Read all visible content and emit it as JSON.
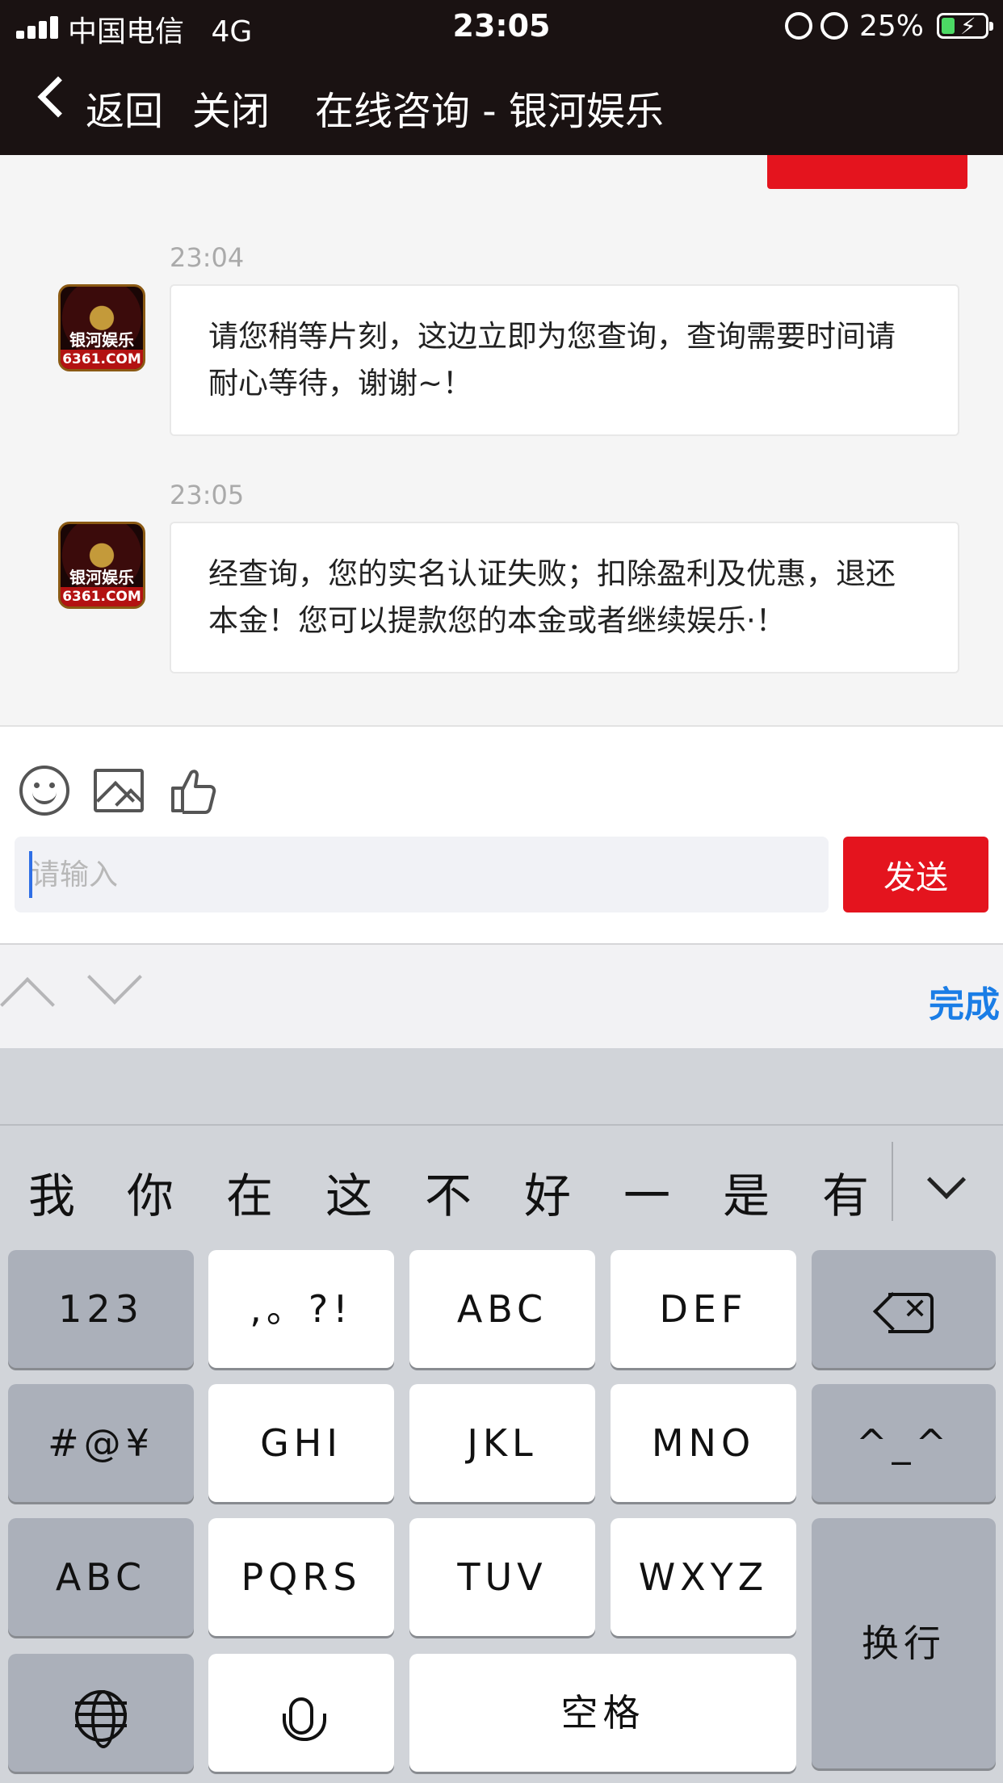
{
  "status_bar": {
    "carrier": "中国电信",
    "network": "4G",
    "time": "23:05",
    "battery_percent": "25%",
    "icons": [
      "signal-icon",
      "orientation-lock-icon",
      "alarm-icon",
      "battery-charging-icon"
    ]
  },
  "nav": {
    "back_label": "返回",
    "close_label": "关闭",
    "title": "在线咨询 - 银河娱乐"
  },
  "avatar": {
    "name": "银河娱乐",
    "domain": "6361.COM"
  },
  "messages": [
    {
      "time": "23:04",
      "text": "请您稍等片刻，这边立即为您查询，查询需要时间请耐心等待，谢谢~！"
    },
    {
      "time": "23:05",
      "text": "经查询，您的实名认证失败；扣除盈利及优惠，退还本金！您可以提款您的本金或者继续娱乐·！"
    }
  ],
  "composer": {
    "tools": [
      "emoji-icon",
      "image-icon",
      "thumbs-up-icon"
    ],
    "placeholder": "请输入",
    "value": "",
    "send_label": "发送"
  },
  "accessory": {
    "done_label": "完成"
  },
  "keyboard": {
    "candidates": [
      "我",
      "你",
      "在",
      "这",
      "不",
      "好",
      "一",
      "是",
      "有"
    ],
    "keys": {
      "num": "123",
      "punct": ",。?!",
      "abc": "ABC",
      "def": "DEF",
      "symbols": "#@¥",
      "ghi": "GHI",
      "jkl": "JKL",
      "mno": "MNO",
      "emoticon": "^_^",
      "switch_abc": "ABC",
      "pqrs": "PQRS",
      "tuv": "TUV",
      "wxyz": "WXYZ",
      "return": "换行",
      "space": "空格"
    }
  },
  "colors": {
    "nav_background": "#1a1212",
    "brand_red": "#e4141e",
    "done_blue": "#1a7de6",
    "keyboard_background": "#d1d4d9"
  }
}
